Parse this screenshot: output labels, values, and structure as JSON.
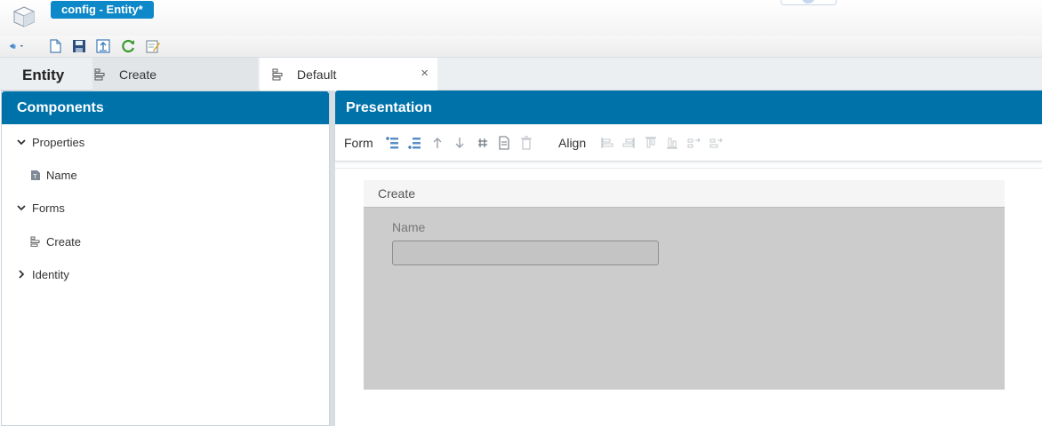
{
  "window": {
    "doc_tab_title": "config - Entity*"
  },
  "toolbar": {
    "buttons": [
      "back-dropdown",
      "new",
      "save",
      "export",
      "refresh",
      "edit"
    ]
  },
  "tabs": {
    "entity_label": "Entity",
    "items": [
      {
        "label": "Create",
        "icon": "form-icon",
        "active": false
      },
      {
        "label": "Default",
        "icon": "form-icon",
        "active": true,
        "close": "×"
      }
    ]
  },
  "components": {
    "title": "Components",
    "tree": [
      {
        "label": "Properties",
        "expanded": true,
        "children": [
          {
            "label": "Name",
            "icon": "text-property-icon"
          }
        ]
      },
      {
        "label": "Forms",
        "expanded": true,
        "children": [
          {
            "label": "Create",
            "icon": "form-icon"
          }
        ]
      },
      {
        "label": "Identity",
        "expanded": false,
        "children": []
      }
    ]
  },
  "presentation": {
    "title": "Presentation",
    "form_label": "Form",
    "align_label": "Align",
    "form_card": {
      "title": "Create",
      "field_label": "Name",
      "field_value": ""
    }
  },
  "colors": {
    "accent": "#0072aa",
    "tab": "#0d88c8",
    "canvas": "#cccccc"
  }
}
